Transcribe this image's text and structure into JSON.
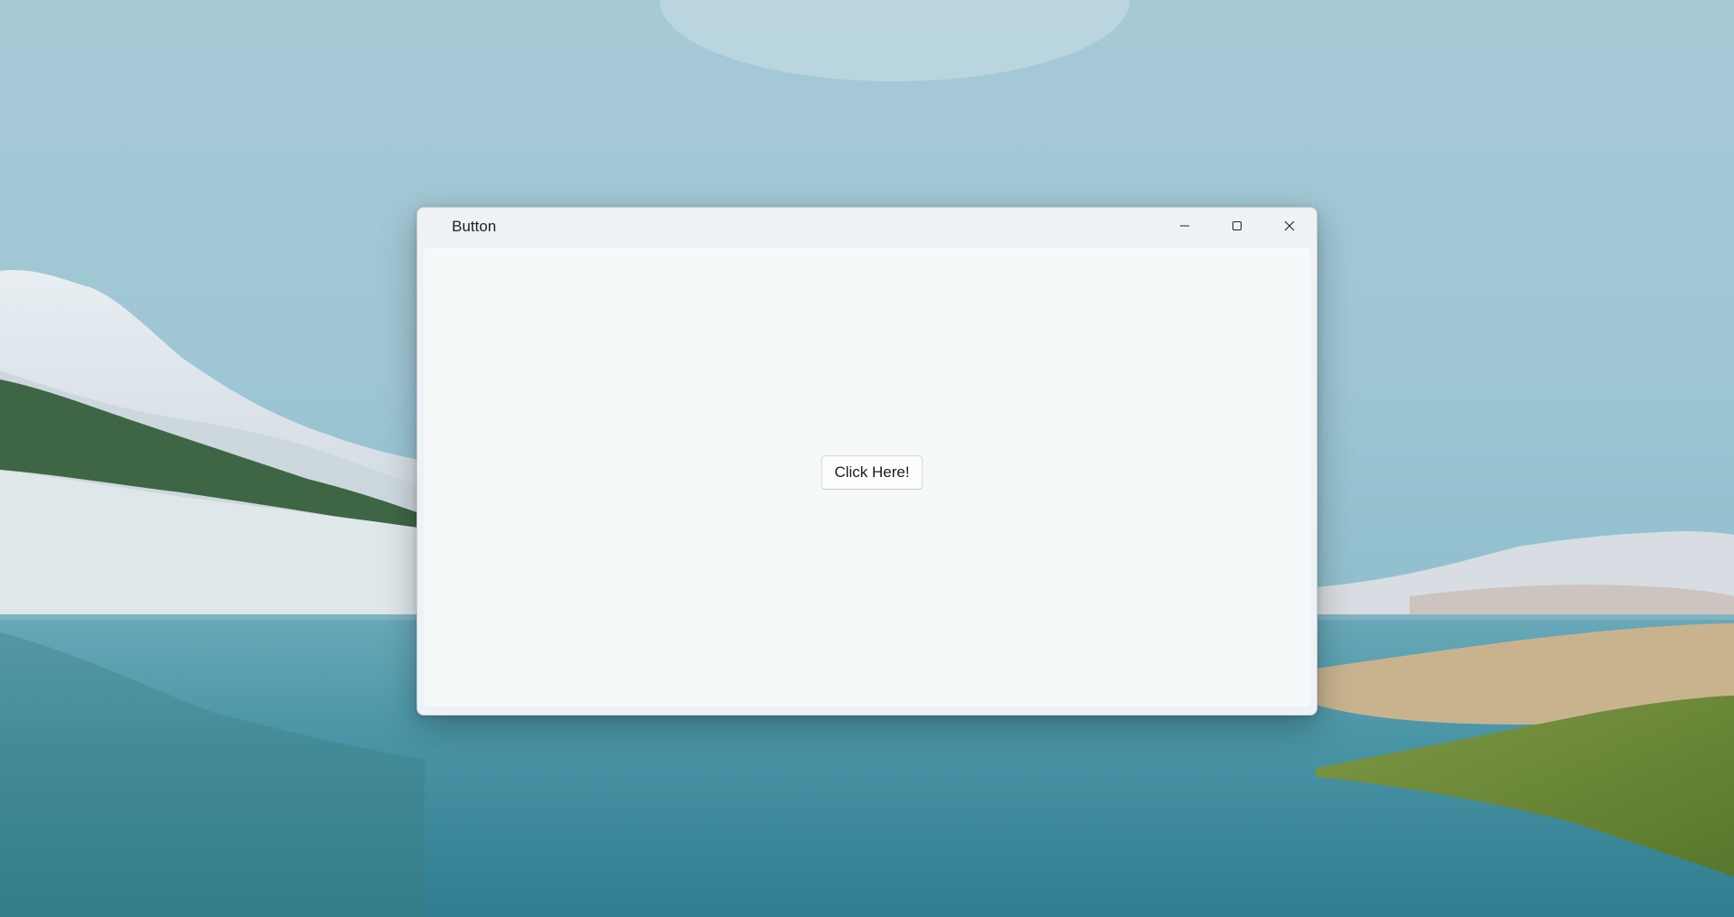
{
  "window": {
    "title": "Button",
    "controls": {
      "minimize_icon": "minimize-icon",
      "maximize_icon": "maximize-icon",
      "close_icon": "close-icon"
    }
  },
  "content": {
    "button_label": "Click Here!"
  },
  "colors": {
    "window_frame": "#eef2f5",
    "client_area": "#f6f9fa",
    "button_face": "#fdfdfd",
    "button_border": "#d6d9dc"
  }
}
